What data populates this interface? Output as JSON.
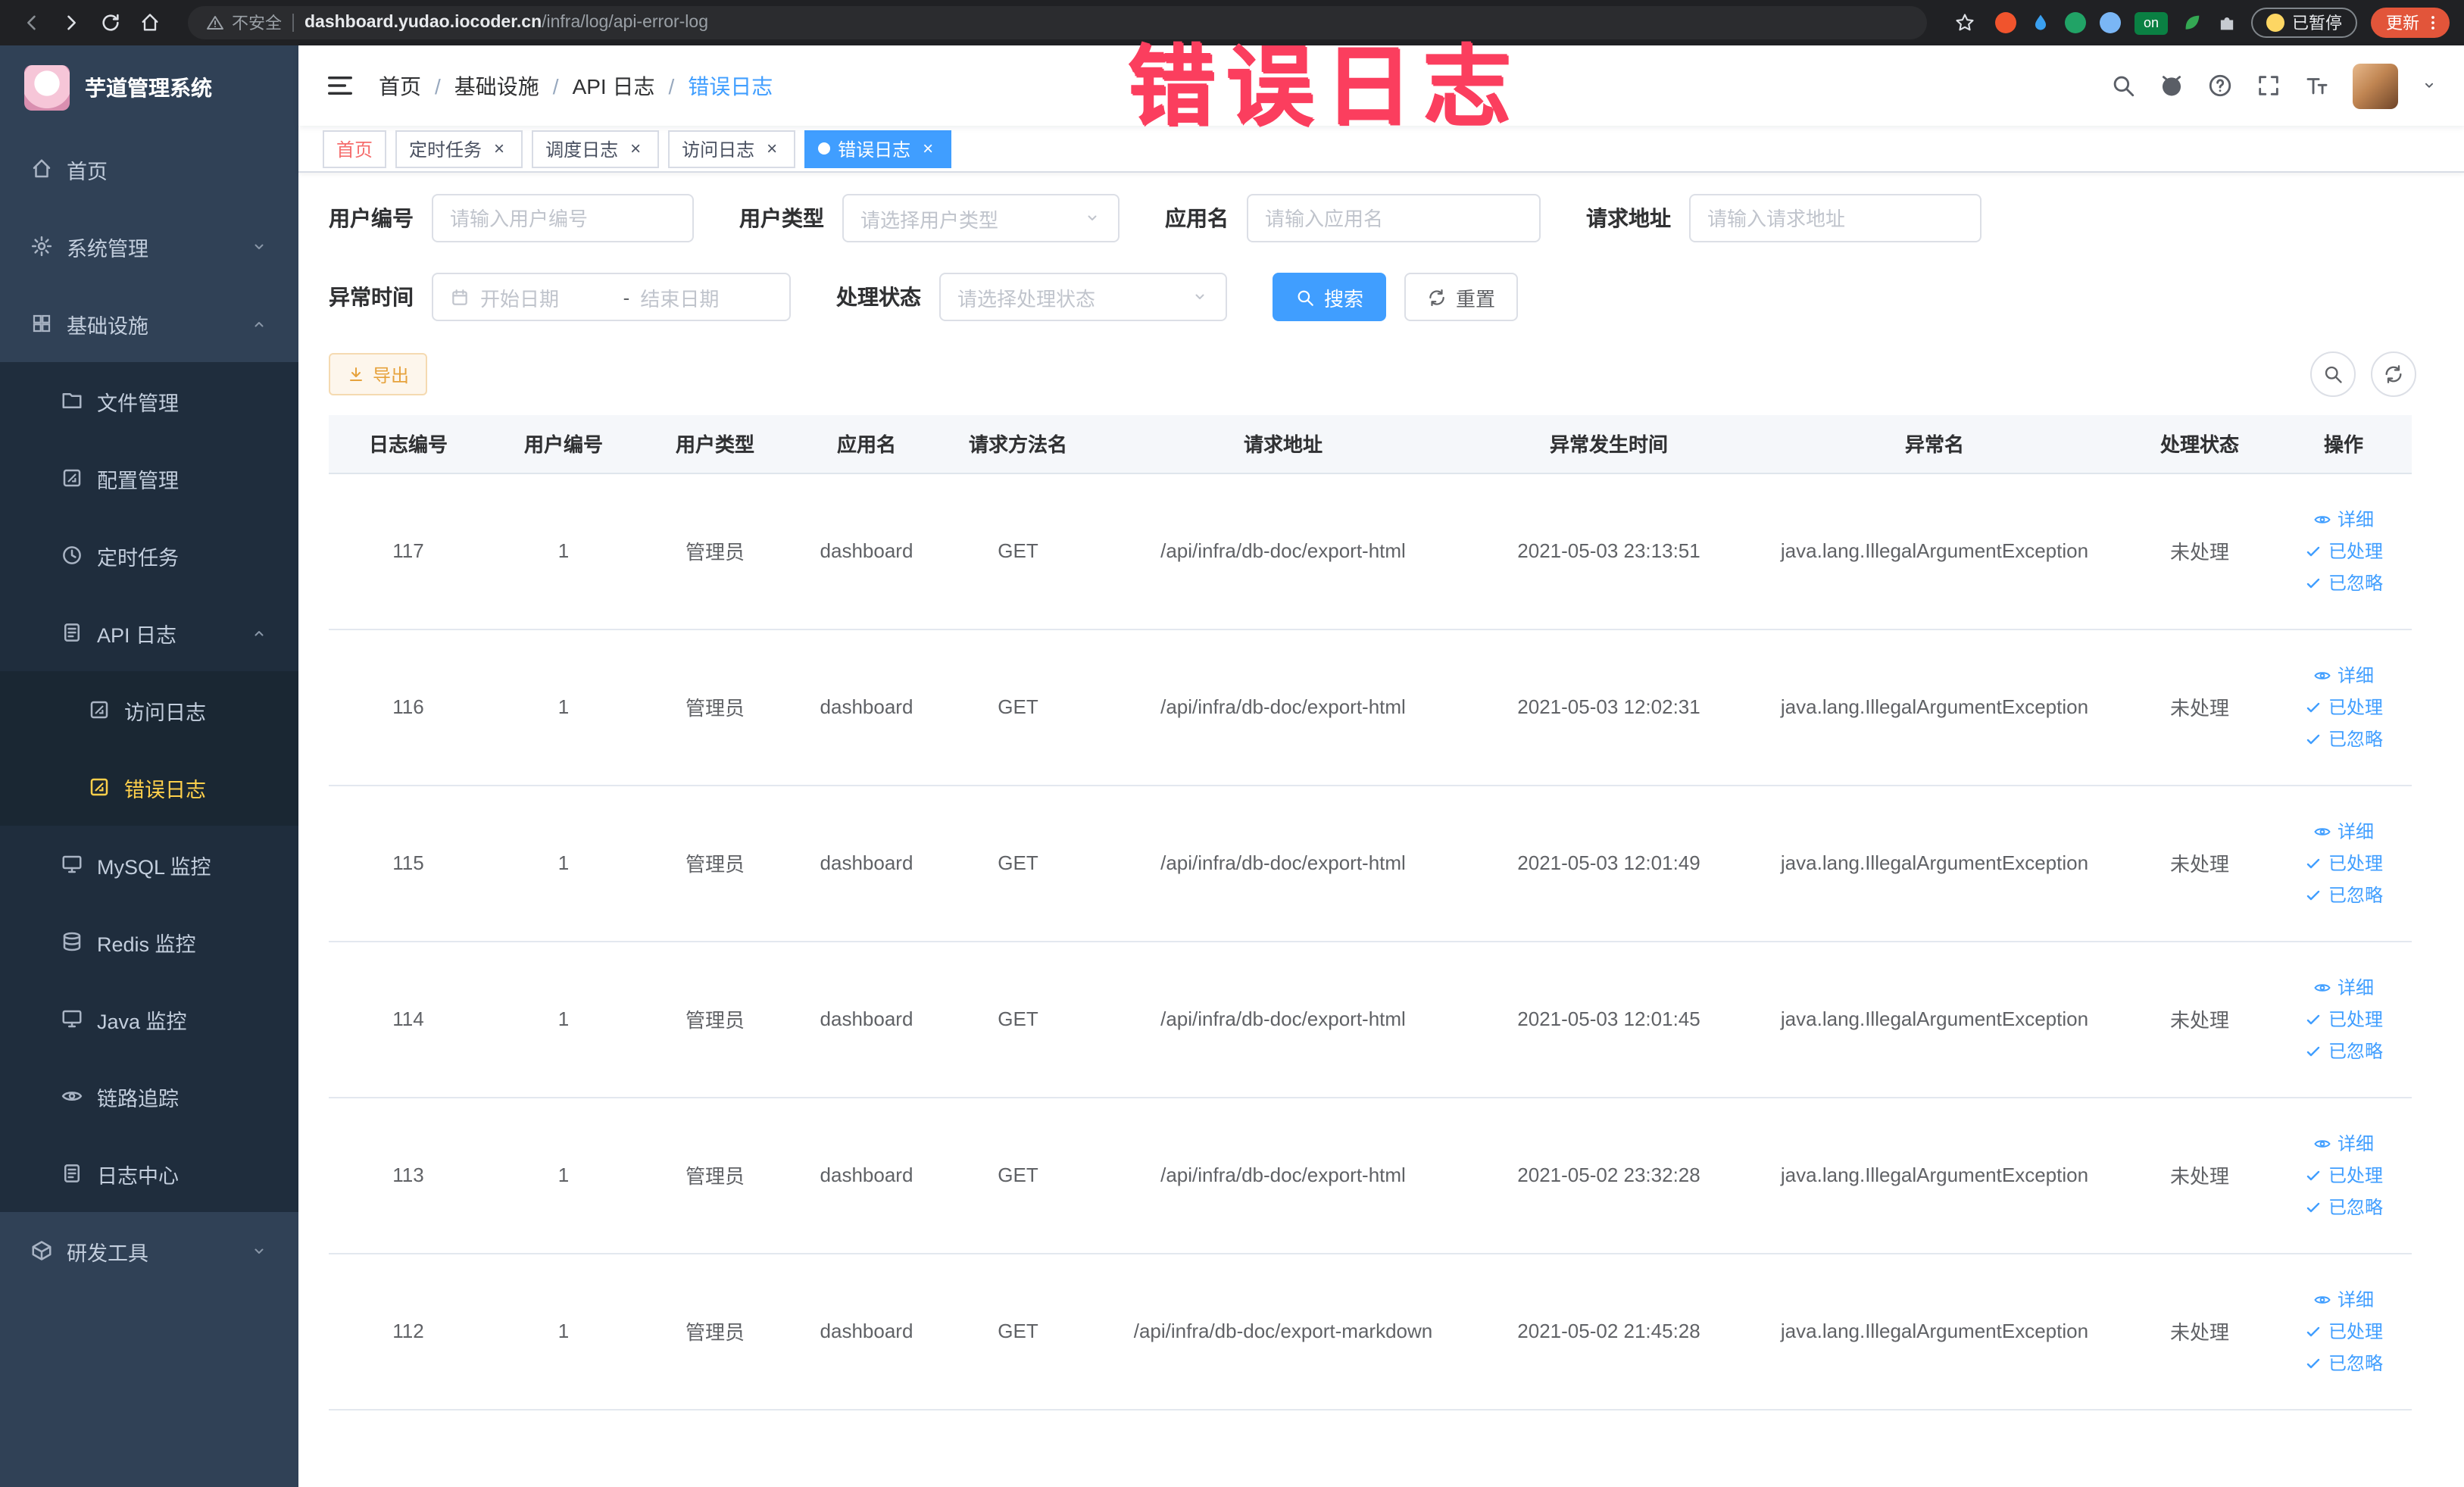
{
  "browser": {
    "security_label": "不安全",
    "url_domain": "dashboard.yudao.iocoder.cn",
    "url_path": "/infra/log/api-error-log",
    "extension_on_badge": "on",
    "paused_badge": "已暂停",
    "update_button": "更新"
  },
  "annotation": {
    "text": "错误日志"
  },
  "sidebar": {
    "logo_title": "芋道管理系统",
    "items": [
      {
        "label": "首页"
      },
      {
        "label": "系统管理"
      },
      {
        "label": "基础设施"
      },
      {
        "label": "文件管理"
      },
      {
        "label": "配置管理"
      },
      {
        "label": "定时任务"
      },
      {
        "label": "API 日志"
      },
      {
        "label": "访问日志"
      },
      {
        "label": "错误日志"
      },
      {
        "label": "MySQL 监控"
      },
      {
        "label": "Redis 监控"
      },
      {
        "label": "Java 监控"
      },
      {
        "label": "链路追踪"
      },
      {
        "label": "日志中心"
      },
      {
        "label": "研发工具"
      }
    ]
  },
  "header": {
    "breadcrumb": [
      "首页",
      "基础设施",
      "API 日志",
      "错误日志"
    ]
  },
  "tabs": [
    {
      "label": "首页"
    },
    {
      "label": "定时任务"
    },
    {
      "label": "调度日志"
    },
    {
      "label": "访问日志"
    },
    {
      "label": "错误日志"
    }
  ],
  "filters": {
    "user_id": {
      "label": "用户编号",
      "placeholder": "请输入用户编号"
    },
    "user_type": {
      "label": "用户类型",
      "placeholder": "请选择用户类型"
    },
    "app_name": {
      "label": "应用名",
      "placeholder": "请输入应用名"
    },
    "request_url": {
      "label": "请求地址",
      "placeholder": "请输入请求地址"
    },
    "exception_time": {
      "label": "异常时间",
      "start_placeholder": "开始日期",
      "separator": "-",
      "end_placeholder": "结束日期"
    },
    "process_status": {
      "label": "处理状态",
      "placeholder": "请选择处理状态"
    },
    "search_button": "搜索",
    "reset_button": "重置"
  },
  "toolbar": {
    "export_button": "导出"
  },
  "table": {
    "columns": [
      "日志编号",
      "用户编号",
      "用户类型",
      "应用名",
      "请求方法名",
      "请求地址",
      "异常发生时间",
      "异常名",
      "处理状态",
      "操作"
    ],
    "actions": [
      "详细",
      "已处理",
      "已忽略"
    ],
    "rows": [
      {
        "id": "117",
        "user_id": "1",
        "user_type": "管理员",
        "app_name": "dashboard",
        "method": "GET",
        "url": "/api/infra/db-doc/export-html",
        "time": "2021-05-03 23:13:51",
        "exception": "java.lang.IllegalArgumentException",
        "status": "未处理"
      },
      {
        "id": "116",
        "user_id": "1",
        "user_type": "管理员",
        "app_name": "dashboard",
        "method": "GET",
        "url": "/api/infra/db-doc/export-html",
        "time": "2021-05-03 12:02:31",
        "exception": "java.lang.IllegalArgumentException",
        "status": "未处理"
      },
      {
        "id": "115",
        "user_id": "1",
        "user_type": "管理员",
        "app_name": "dashboard",
        "method": "GET",
        "url": "/api/infra/db-doc/export-html",
        "time": "2021-05-03 12:01:49",
        "exception": "java.lang.IllegalArgumentException",
        "status": "未处理"
      },
      {
        "id": "114",
        "user_id": "1",
        "user_type": "管理员",
        "app_name": "dashboard",
        "method": "GET",
        "url": "/api/infra/db-doc/export-html",
        "time": "2021-05-03 12:01:45",
        "exception": "java.lang.IllegalArgumentException",
        "status": "未处理"
      },
      {
        "id": "113",
        "user_id": "1",
        "user_type": "管理员",
        "app_name": "dashboard",
        "method": "GET",
        "url": "/api/infra/db-doc/export-html",
        "time": "2021-05-02 23:32:28",
        "exception": "java.lang.IllegalArgumentException",
        "status": "未处理"
      },
      {
        "id": "112",
        "user_id": "1",
        "user_type": "管理员",
        "app_name": "dashboard",
        "method": "GET",
        "url": "/api/infra/db-doc/export-markdown",
        "time": "2021-05-02 21:45:28",
        "exception": "java.lang.IllegalArgumentException",
        "status": "未处理"
      }
    ]
  }
}
